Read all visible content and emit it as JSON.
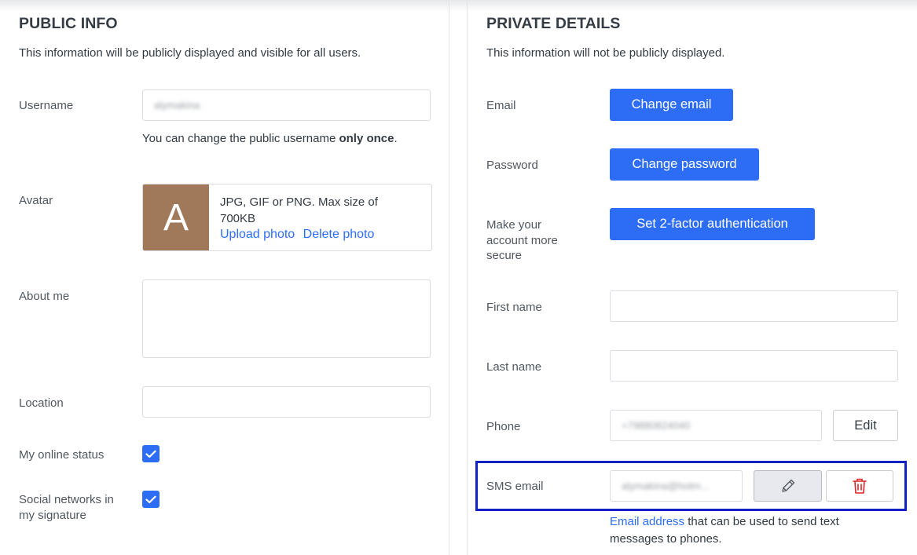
{
  "public": {
    "title": "PUBLIC INFO",
    "subtitle": "This information will be publicly displayed and visible for all users.",
    "username": {
      "label": "Username",
      "value": "alymakina",
      "hint_prefix": "You can change the public username ",
      "hint_bold": "only once",
      "hint_suffix": "."
    },
    "avatar": {
      "label": "Avatar",
      "letter": "A",
      "letter_bg": "#a0785a",
      "info_line1": "JPG, GIF or PNG. Max size of",
      "info_line2": "700KB",
      "upload_label": "Upload photo",
      "delete_label": "Delete photo"
    },
    "about_me": {
      "label": "About me",
      "value": ""
    },
    "location": {
      "label": "Location",
      "value": ""
    },
    "online_status": {
      "label": "My online status",
      "checked": true
    },
    "social_networks": {
      "label_line1": "Social networks in",
      "label_line2": "my signature",
      "checked": true
    }
  },
  "private": {
    "title": "PRIVATE DETAILS",
    "subtitle": "This information will not be publicly displayed.",
    "email": {
      "label": "Email",
      "button": "Change email"
    },
    "password": {
      "label": "Password",
      "button": "Change password"
    },
    "security": {
      "label_line1": "Make your",
      "label_line2": "account more",
      "label_line3": "secure",
      "button": "Set 2-factor authentication"
    },
    "first_name": {
      "label": "First name",
      "value": ""
    },
    "last_name": {
      "label": "Last name",
      "value": ""
    },
    "phone": {
      "label": "Phone",
      "value": "+79880824040",
      "edit_label": "Edit"
    },
    "sms_email": {
      "label": "SMS email",
      "value": "alymakina@hotm...",
      "help_link": "Email address",
      "help_line1_rest": " that can be used to send text",
      "help_line2": "messages to phones."
    }
  },
  "colors": {
    "accent": "#2d6df6",
    "highlight_border": "#1121c4",
    "delete_red": "#e02424"
  },
  "icons": {
    "checkbox": "check-icon",
    "edit": "pencil-icon",
    "delete": "trash-icon"
  }
}
